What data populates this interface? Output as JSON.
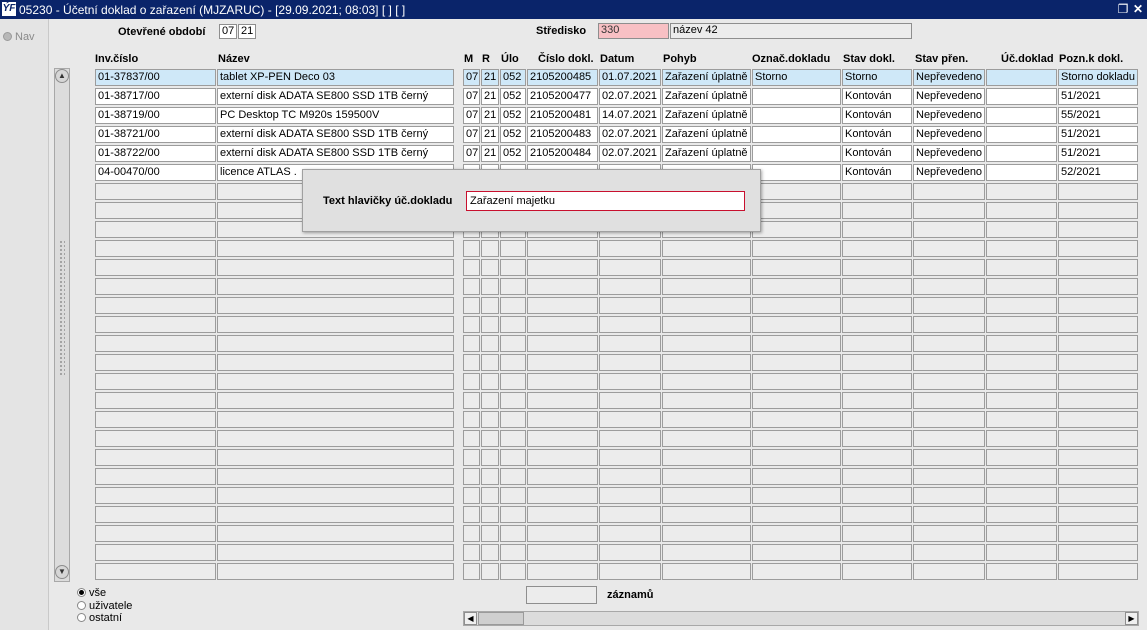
{
  "window": {
    "app_icon": "ÝF",
    "title": "05230 - Účetní doklad o zařazení (MJZARUC) - [29.09.2021; 08:03]  [ ]  [ ]",
    "restore_icon": "restore-icon",
    "close_icon": "close-icon"
  },
  "nav": {
    "label": "Nav"
  },
  "header": {
    "period_label": "Otevřené období",
    "period_month": "07",
    "period_year": "21",
    "centre_label": "Středisko",
    "centre_code": "330",
    "centre_name": "název 42"
  },
  "columns": [
    "Inv.číslo",
    "Název",
    "M",
    "R",
    "Úlo",
    "Číslo dokl.",
    "Datum",
    "Pohyb",
    "Označ.dokladu",
    "Stav dokl.",
    "Stav přen.",
    "Úč.doklad",
    "Pozn.k dokl."
  ],
  "rows": [
    [
      "01-37837/00",
      "tablet XP-PEN Deco 03",
      "07",
      "21",
      "052",
      "2105200485",
      "01.07.2021",
      "Zařazení úplatně",
      "Storno",
      "Storno",
      "Nepřevedeno",
      "",
      "Storno dokladu"
    ],
    [
      "01-38717/00",
      "externí disk ADATA SE800 SSD 1TB černý",
      "07",
      "21",
      "052",
      "2105200477",
      "02.07.2021",
      "Zařazení úplatně",
      "",
      "Kontován",
      "Nepřevedeno",
      "",
      "51/2021"
    ],
    [
      "01-38719/00",
      "PC Desktop TC M920s 159500V",
      "07",
      "21",
      "052",
      "2105200481",
      "14.07.2021",
      "Zařazení úplatně",
      "",
      "Kontován",
      "Nepřevedeno",
      "",
      "55/2021"
    ],
    [
      "01-38721/00",
      "externí disk ADATA SE800 SSD 1TB černý",
      "07",
      "21",
      "052",
      "2105200483",
      "02.07.2021",
      "Zařazení úplatně",
      "",
      "Kontován",
      "Nepřevedeno",
      "",
      "51/2021"
    ],
    [
      "01-38722/00",
      "externí disk ADATA SE800 SSD 1TB černý",
      "07",
      "21",
      "052",
      "2105200484",
      "02.07.2021",
      "Zařazení úplatně",
      "",
      "Kontován",
      "Nepřevedeno",
      "",
      "51/2021"
    ],
    [
      "04-00470/00",
      "licence ATLAS .",
      "",
      "",
      "",
      "",
      "",
      "",
      "",
      "Kontován",
      "Nepřevedeno",
      "",
      "52/2021"
    ]
  ],
  "dialog": {
    "label": "Text hlavičky úč.dokladu",
    "value": "Zařazení majetku"
  },
  "filter": {
    "options": [
      "vše",
      "uživatele",
      "ostatní"
    ],
    "selected": "vše"
  },
  "footer": {
    "records_value": "",
    "records_label": "záznamů"
  },
  "colors": {
    "titlebar": "#0a246a",
    "selected_row": "#cfe8f8",
    "required_field": "#f8c0c4",
    "dialog_border": "#c8102e"
  }
}
